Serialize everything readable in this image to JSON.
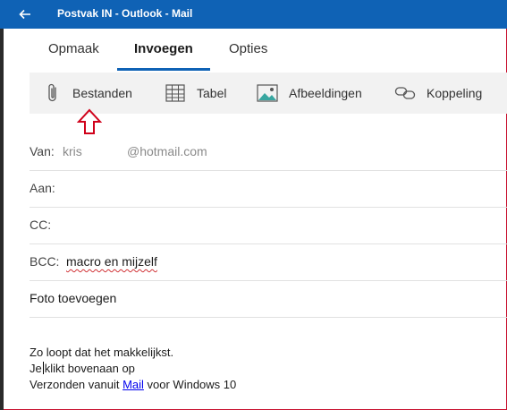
{
  "window": {
    "title": "Postvak IN - Outlook - Mail"
  },
  "tabs": [
    {
      "label": "Opmaak"
    },
    {
      "label": "Invoegen"
    },
    {
      "label": "Opties"
    }
  ],
  "toolbar": {
    "files_label": "Bestanden",
    "table_label": "Tabel",
    "images_label": "Afbeeldingen",
    "link_label": "Koppeling"
  },
  "fields": {
    "from": {
      "label": "Van:",
      "name": "kris",
      "domain": "@hotmail.com"
    },
    "to": {
      "label": "Aan:"
    },
    "cc": {
      "label": "CC:"
    },
    "bcc": {
      "label": "BCC:",
      "value": "macro en mijzelf"
    }
  },
  "subject": {
    "value": "Foto toevoegen"
  },
  "body": {
    "line1": "Zo loopt dat het makkelijkst.",
    "line2_before": "Je",
    "line2_after": "klikt bovenaan op",
    "line3_before": "Verzonden vanuit ",
    "line3_link": "Mail",
    "line3_after": " voor Windows 10"
  },
  "colors": {
    "titlebar": "#0f62b5",
    "accent": "#0f62b5",
    "annotation_arrow": "#d0021b",
    "spellcheck": "#d13438"
  }
}
